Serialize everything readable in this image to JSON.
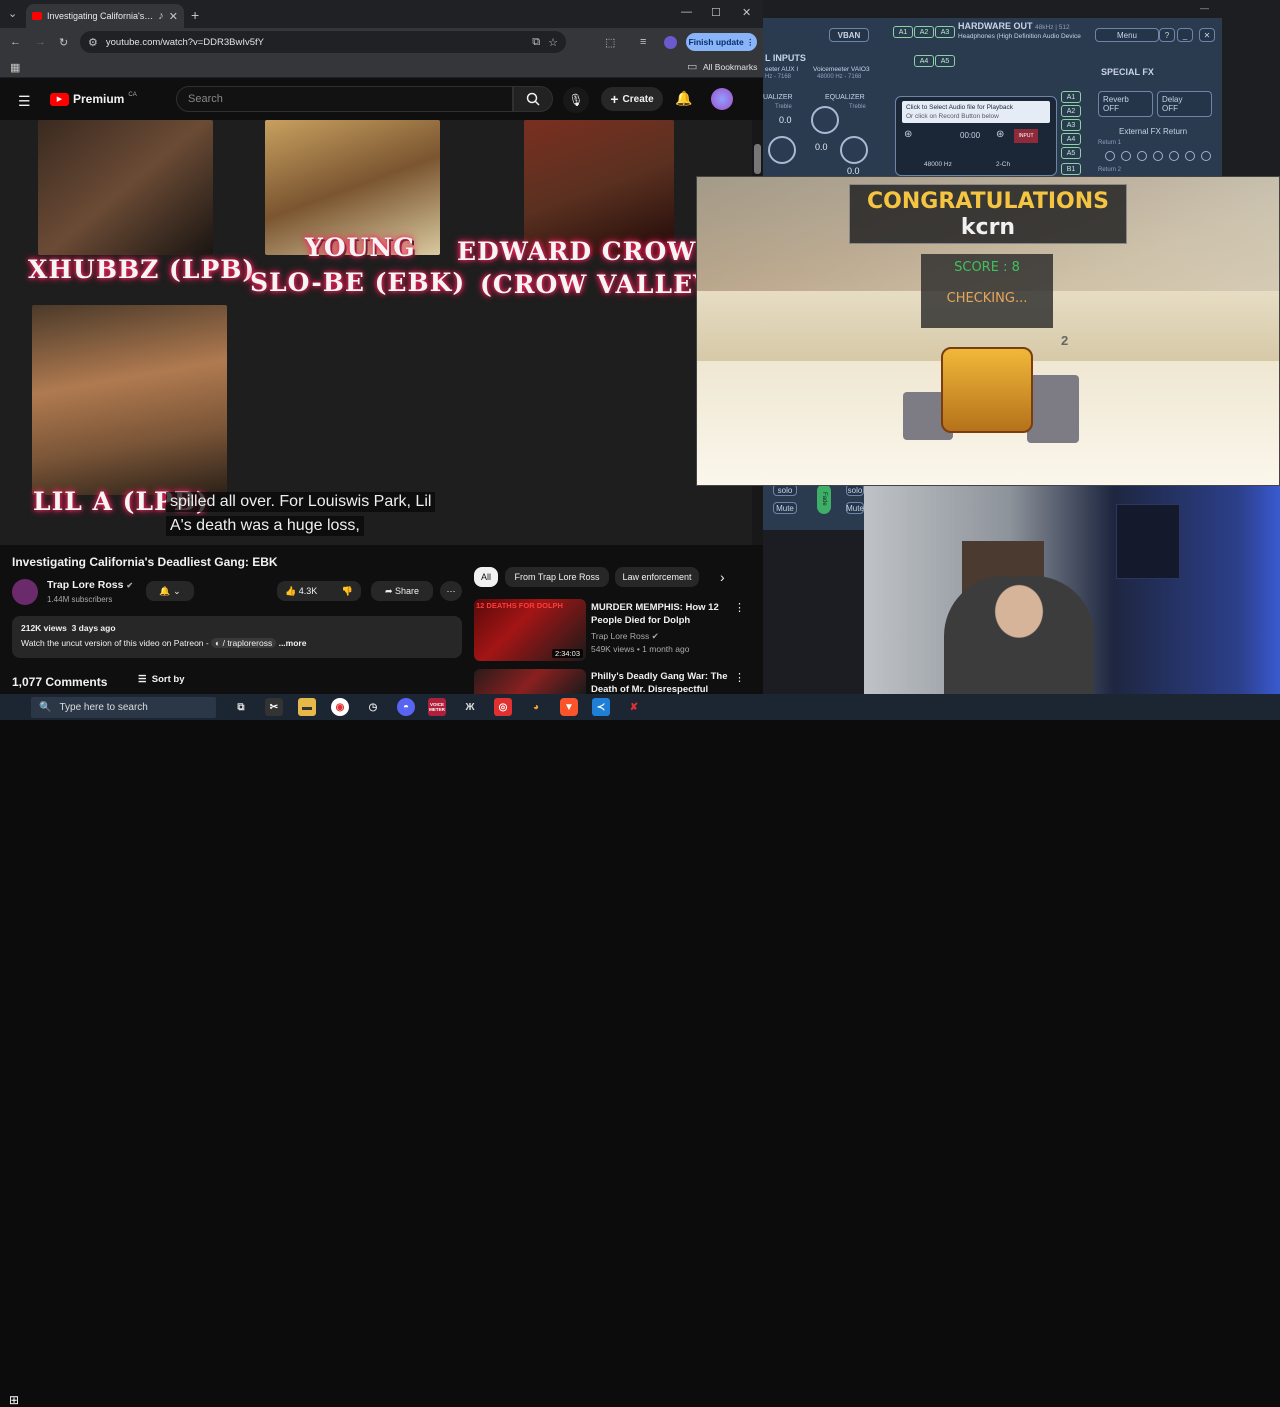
{
  "browser": {
    "tab_title": "Investigating California's De",
    "url": "youtube.com/watch?v=DDR3BwIv5fY",
    "update_button": "Finish update",
    "all_bookmarks": "All Bookmarks"
  },
  "youtube": {
    "logo_text": "Premium",
    "region": "CA",
    "search_placeholder": "Search",
    "create_label": "Create",
    "video": {
      "overlay_labels": {
        "left_top": "XHUBBZ (LPB)",
        "center_line1": "YOUNG",
        "center_line2": "SLO-BE (EBK)",
        "right_line1": "EDWARD CROWLI",
        "right_line2": "(CROW VALLEY)",
        "bottom_left": "LIL A (LPB)"
      },
      "caption_line1": "spilled all over. For Louiswis Park, Lil",
      "caption_line2": "A's death was a huge loss,"
    },
    "title": "Investigating California's Deadliest Gang: EBK",
    "channel": "Trap Lore Ross",
    "subscribers": "1.44M subscribers",
    "likes": "4.3K",
    "share": "Share",
    "views": "212K views",
    "age": "3 days ago",
    "description": "Watch the uncut version of this video on Patreon - ",
    "patreon_link": "/ traploreross",
    "more": "...more",
    "comments_count": "1,077 Comments",
    "sort_by": "Sort by",
    "filter_pills": [
      "All",
      "From Trap Lore Ross",
      "Law enforcement"
    ],
    "recommendations": [
      {
        "thumb_text": "12 DEATHS FOR DOLPH",
        "duration": "2:34:03",
        "title": "MURDER MEMPHIS: How 12 People Died for Dolph",
        "channel": "Trap Lore Ross",
        "meta": "549K views • 1 month ago"
      },
      {
        "thumb_text": "",
        "duration": "",
        "title": "Philly's Deadly Gang War: The Death of Mr. Disrespectful",
        "channel": "",
        "meta": ""
      }
    ]
  },
  "voicemeeter": {
    "vban": "VBAN",
    "buses_top": [
      "A1",
      "A2",
      "A3"
    ],
    "buses_mid": [
      "A4",
      "A5"
    ],
    "hardware_out": "HARDWARE OUT",
    "hardware_out_fmt": "48kHz | 512",
    "hardware_device": "Headphones (High Definition Audio Device",
    "menu": "Menu",
    "help": "?",
    "inputs_label": "L INPUTS",
    "input_aux": "eeter AUX I",
    "input_aux_fmt": "Hz - 7168",
    "input_vaio3": "Voicemeeter VAIO3",
    "input_vaio3_fmt": "48000 Hz - 7168",
    "special_fx": "SPECIAL FX",
    "reverb": "Reverb",
    "delay": "Delay",
    "reverb_state": "OFF",
    "delay_state": "OFF",
    "external_fx": "External FX Return",
    "return1": "Return 1",
    "return2": "Return 2",
    "equalizer": "EQUALIZER",
    "equalizer_left": "UALIZER",
    "treble": "Treble",
    "knob_value": "0.0",
    "player_prompt": "Click to Select Audio file for Playback",
    "player_sub": "Or click on Record Button below",
    "player_time": "00:00",
    "player_rate": "48000 Hz",
    "player_ch": "2-Ch",
    "player_badge": "INPUT",
    "player_buses": [
      "A1",
      "A2",
      "A3",
      "A4",
      "A5",
      "B1"
    ],
    "solo": "solo",
    "mute": "Mute",
    "fader": "Fade"
  },
  "game": {
    "congrats": "CONGRATULATIONS",
    "username": "kcrn",
    "score": "SCORE : 8",
    "status": "CHECKING...",
    "tower_number": "2"
  },
  "taskbar": {
    "search_placeholder": "Type here to search",
    "app_badge": "VOICE METER"
  }
}
